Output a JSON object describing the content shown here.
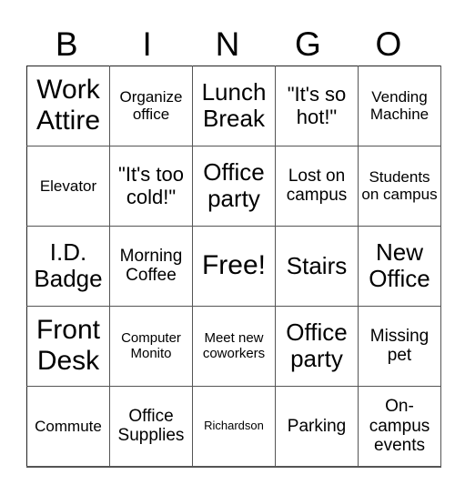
{
  "header": {
    "letters": [
      "B",
      "I",
      "N",
      "G",
      "O"
    ]
  },
  "card": {
    "rows": [
      [
        "Work Attire",
        "Organize office",
        "Lunch Break",
        "\"It's so hot!\"",
        "Vending Machine"
      ],
      [
        "Elevator",
        "\"It's too cold!\"",
        "Office party",
        "Lost on campus",
        "Students on campus"
      ],
      [
        "I.D. Badge",
        "Morning Coffee",
        "Free!",
        "Stairs",
        "New Office"
      ],
      [
        "Front Desk",
        "Computer Monito",
        "Meet new coworkers",
        "Office party",
        "Missing pet"
      ],
      [
        "Commute",
        "Office Supplies",
        "Richardson",
        "Parking",
        "On-campus events"
      ]
    ],
    "free_space": "Free!"
  }
}
